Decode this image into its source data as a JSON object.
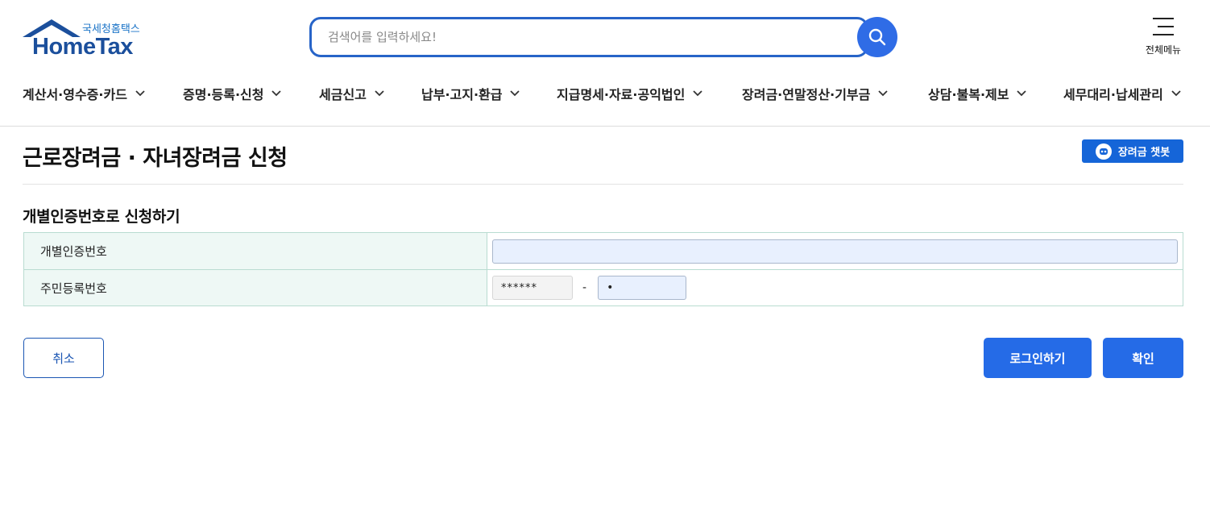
{
  "header": {
    "logo_sub": "국세청홈택스",
    "logo_main": "HomeTax",
    "search_placeholder": "검색어를 입력하세요!",
    "all_menu_label": "전체메뉴"
  },
  "gnb": [
    {
      "label": "계산서·영수증·카드"
    },
    {
      "label": "증명·등록·신청"
    },
    {
      "label": "세금신고"
    },
    {
      "label": "납부·고지·환급"
    },
    {
      "label": "지급명세·자료·공익법인"
    },
    {
      "label": "장려금·연말정산·기부금"
    },
    {
      "label": "상담·불복·제보"
    },
    {
      "label": "세무대리·납세관리"
    }
  ],
  "page": {
    "title": "근로장려금 · 자녀장려금 신청",
    "chatbot_label": "장려금 챗봇",
    "section_title": "개별인증번호로 신청하기"
  },
  "form": {
    "auth_label": "개별인증번호",
    "auth_value": "",
    "rrn_label": "주민등록번호",
    "rrn_front": "******",
    "rrn_dash": "-",
    "rrn_back": "•"
  },
  "buttons": {
    "cancel": "취소",
    "login": "로그인하기",
    "confirm": "확인"
  },
  "colors": {
    "primary": "#256be7",
    "logo_blue": "#1b4f9c",
    "table_head_bg": "#eef8f5",
    "input_bg": "#e8f0fe"
  }
}
